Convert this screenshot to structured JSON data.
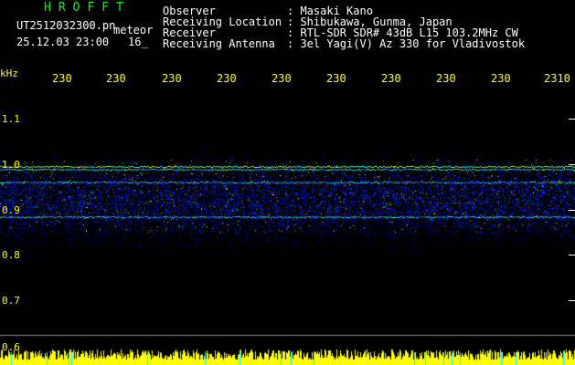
{
  "header": {
    "logo": "HROFFT",
    "file_name": "UT2512032300.pn",
    "meteor_label": "meteor",
    "datetime": "25.12.03 23:00",
    "count": "16_",
    "info": [
      {
        "label": "Observer",
        "value": ": Masaki Kano"
      },
      {
        "label": "Receiving Location",
        "value": ": Shibukawa, Gunma, Japan"
      },
      {
        "label": "Receiver",
        "value": ": RTL-SDR SDR# 43dB L15 103.2MHz CW"
      },
      {
        "label": "Receiving Antenna",
        "value": ": 3el Yagi(V) Az 330 for Vladivostok"
      }
    ]
  },
  "axis": {
    "unit": "kHz",
    "x_ticks": [
      "230",
      "230",
      "230",
      "230",
      "230",
      "230",
      "230",
      "230",
      "230",
      "2310"
    ],
    "y_ticks": [
      "1.1",
      "1.0",
      "0.9",
      "0.8",
      "0.7",
      "0.6"
    ]
  },
  "colors": {
    "logo": "#00ff00",
    "header_text": "#ffffff",
    "tick_text": "#ffff00",
    "axis_text": "#ffff00",
    "plot_bg": "#000000"
  }
}
